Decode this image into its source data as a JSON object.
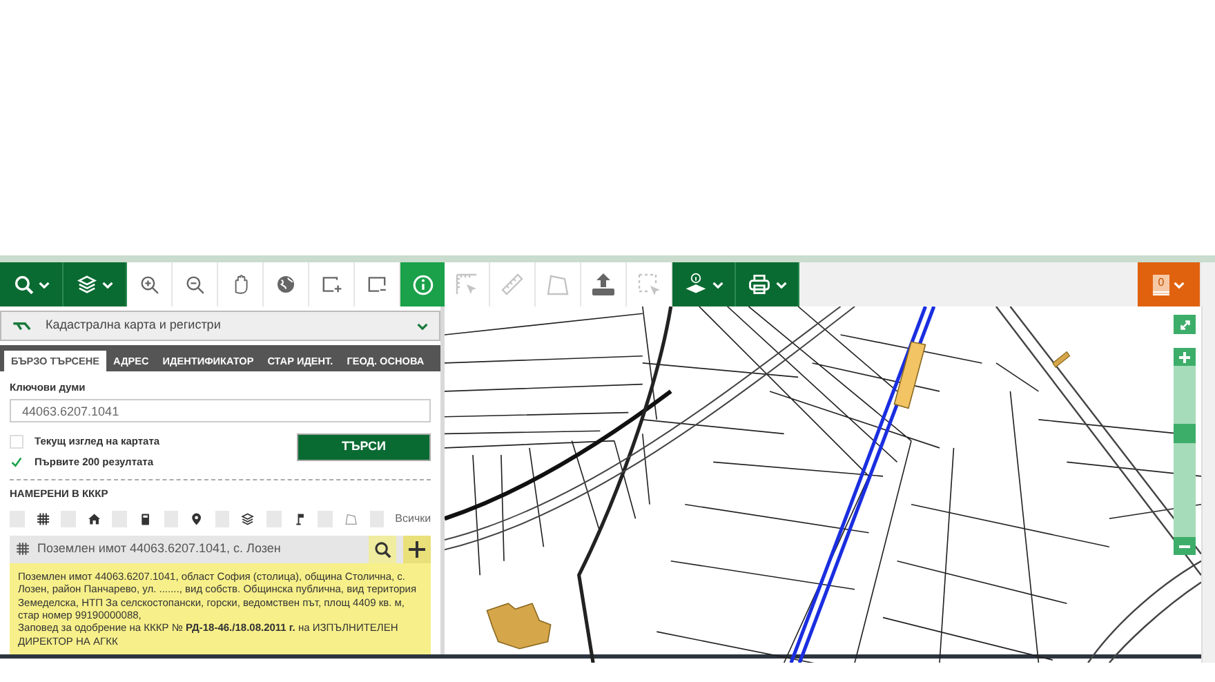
{
  "main_tools": [
    {
      "kind": "search",
      "dropdown": true,
      "selected": false
    },
    {
      "kind": "layers",
      "dropdown": true,
      "selected": false
    },
    {
      "kind": "zoom-in",
      "dropdown": false,
      "selected": false
    },
    {
      "kind": "zoom-out",
      "dropdown": false,
      "selected": false
    },
    {
      "kind": "hand",
      "dropdown": false,
      "selected": false
    },
    {
      "kind": "globe",
      "dropdown": false,
      "selected": false
    },
    {
      "kind": "rect-plus",
      "dropdown": false,
      "selected": false
    },
    {
      "kind": "rect-minus",
      "dropdown": false,
      "selected": false
    },
    {
      "kind": "info",
      "dropdown": false,
      "selected": true
    }
  ],
  "map_tools": [
    {
      "kind": "measure-area",
      "dropdown": false,
      "disabled": true
    },
    {
      "kind": "ruler",
      "dropdown": false,
      "disabled": true
    },
    {
      "kind": "polygon",
      "dropdown": false,
      "disabled": true
    },
    {
      "kind": "upload",
      "dropdown": false,
      "disabled": false
    },
    {
      "kind": "select-area",
      "dropdown": false,
      "disabled": true
    },
    {
      "kind": "layer-info",
      "dropdown": true,
      "disabled": false
    },
    {
      "kind": "print",
      "dropdown": true,
      "disabled": false
    }
  ],
  "cart": {
    "count": "0",
    "dropdown": true
  },
  "layer_select": {
    "label": "Кадастрална карта и регистри"
  },
  "tabs": [
    {
      "label": "БЪРЗО ТЪРСЕНЕ",
      "selected": true
    },
    {
      "label": "АДРЕС",
      "selected": false
    },
    {
      "label": "ИДЕНТИФИКАТОР",
      "selected": false
    },
    {
      "label": "СТАР ИДЕНТ.",
      "selected": false
    },
    {
      "label": "ГЕОД. ОСНОВА",
      "selected": false
    }
  ],
  "keywords": {
    "label": "Ключови думи",
    "value": "44063.6207.1041"
  },
  "options": [
    {
      "label": "Текущ изглед на картата",
      "checked": false
    },
    {
      "label": "Първите 200 резултата",
      "checked": true
    }
  ],
  "search_button": "ТЪРСИ",
  "results": {
    "heading": "НАМЕРЕНИ В КККР",
    "filters": [
      {
        "kind": "parcel",
        "checked": false
      },
      {
        "kind": "building",
        "checked": false
      },
      {
        "kind": "apartment",
        "checked": false
      },
      {
        "kind": "address",
        "checked": false
      },
      {
        "kind": "layers",
        "checked": false
      },
      {
        "kind": "marker",
        "checked": false
      },
      {
        "kind": "polygon",
        "checked": false
      }
    ],
    "all_filter": {
      "label": "Всички",
      "checked": false
    },
    "item": {
      "title": "Поземлен имот 44063.6207.1041, с. Лозен",
      "details": [
        "Поземлен имот 44063.6207.1041, област София (столица), община Столична, с. Лозен, район Панчарево, ул. ......., вид собств. Общинска публична, вид територия Земеделска, НТП За селскостопански, горски, ведомствен път, площ 4409 кв. м, стар номер 99190000088,",
        "Заповед за одобрение на КККР № **РД-18-46./18.08.2011 г.** на ИЗПЪЛНИТЕЛЕН ДИРЕКТОР НА АГКК"
      ]
    }
  },
  "zoom_slider": {
    "level": 0.62
  }
}
